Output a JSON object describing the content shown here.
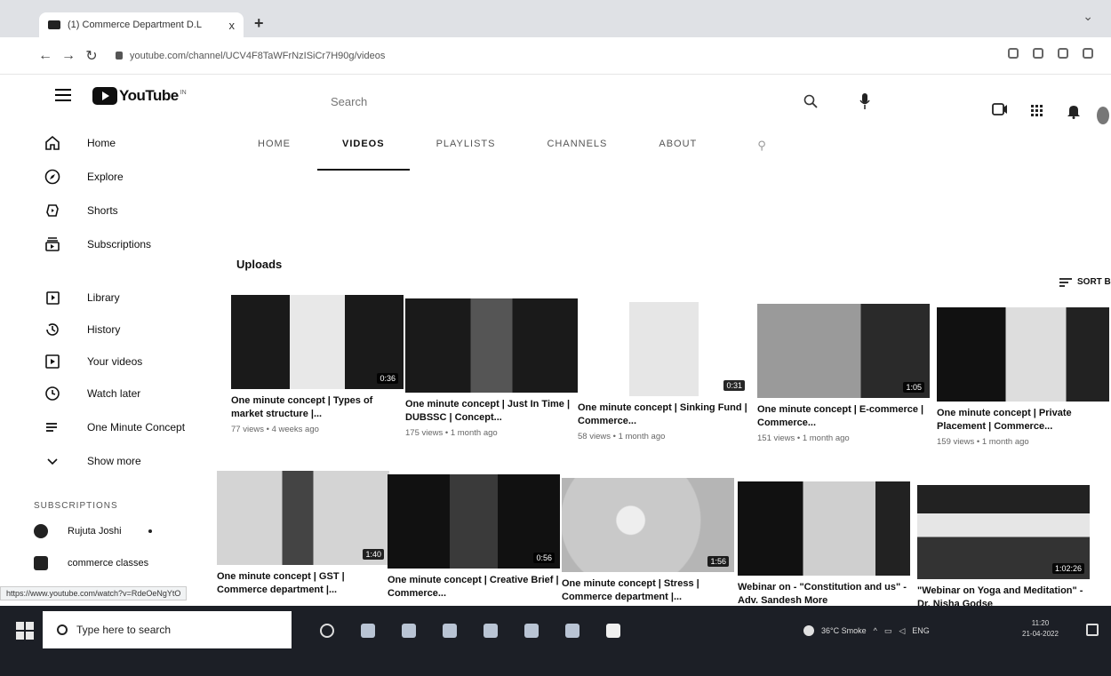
{
  "browser": {
    "tab_title": "(1) Commerce Department D.L",
    "tab_close": "x",
    "new_tab": "+",
    "url": "youtube.com/channel/UCV4F8TaWFrNzISiCr7H90g/videos"
  },
  "header": {
    "logo_text": "YouTube",
    "logo_sup": "IN",
    "search_placeholder": "Search"
  },
  "sidebar": {
    "main": [
      {
        "label": "Home",
        "icon": "home-icon"
      },
      {
        "label": "Explore",
        "icon": "compass-icon"
      },
      {
        "label": "Shorts",
        "icon": "shorts-icon"
      },
      {
        "label": "Subscriptions",
        "icon": "subscriptions-icon"
      }
    ],
    "library": [
      {
        "label": "Library",
        "icon": "library-icon"
      },
      {
        "label": "History",
        "icon": "history-icon"
      },
      {
        "label": "Your videos",
        "icon": "your-videos-icon"
      },
      {
        "label": "Watch later",
        "icon": "clock-icon"
      },
      {
        "label": "One Minute Concept",
        "icon": "playlist-icon"
      },
      {
        "label": "Show more",
        "icon": "chevron-down-icon"
      }
    ],
    "subscriptions_heading": "SUBSCRIPTIONS",
    "subscriptions": [
      {
        "name": "Rujuta Joshi"
      },
      {
        "name": "commerce classes"
      }
    ]
  },
  "channel_tabs": [
    "HOME",
    "VIDEOS",
    "PLAYLISTS",
    "CHANNELS",
    "ABOUT"
  ],
  "active_tab": "VIDEOS",
  "uploads_heading": "Uploads",
  "sort_label": "SORT B",
  "videos": [
    {
      "title": "One minute concept | Types of market structure |...",
      "meta": "77 views • 4 weeks ago",
      "duration": "0:36"
    },
    {
      "title": "One minute concept | Just In Time | DUBSSC | Concept...",
      "meta": "175 views • 1 month ago",
      "duration": ""
    },
    {
      "title": "One minute concept | Sinking Fund | Commerce...",
      "meta": "58 views • 1 month ago",
      "duration": "0:31"
    },
    {
      "title": "One minute concept | E-commerce | Commerce...",
      "meta": "151 views • 1 month ago",
      "duration": "1:05"
    },
    {
      "title": "One minute concept | Private Placement | Commerce...",
      "meta": "159 views • 1 month ago",
      "duration": ""
    },
    {
      "title": "One minute concept | GST | Commerce department |...",
      "meta": "",
      "duration": "1:40"
    },
    {
      "title": "One minute concept | Creative Brief | Commerce...",
      "meta": "",
      "duration": "0:56"
    },
    {
      "title": "One minute concept | Stress | Commerce department |...",
      "meta": "",
      "duration": "1:56"
    },
    {
      "title": "Webinar on - \"Constitution and us\" - Adv. Sandesh More",
      "meta": "",
      "duration": ""
    },
    {
      "title": "\"Webinar on Yoga and Meditation\" - Dr. Nisha Godse",
      "meta": "",
      "duration": "1:02:26"
    }
  ],
  "status_url": "https://www.youtube.com/watch?v=RdeOeNgYtO",
  "taskbar": {
    "search_placeholder": "Type here to search",
    "weather": "36°C Smoke",
    "lang": "ENG",
    "time": "11:20",
    "date": "21-04-2022"
  }
}
